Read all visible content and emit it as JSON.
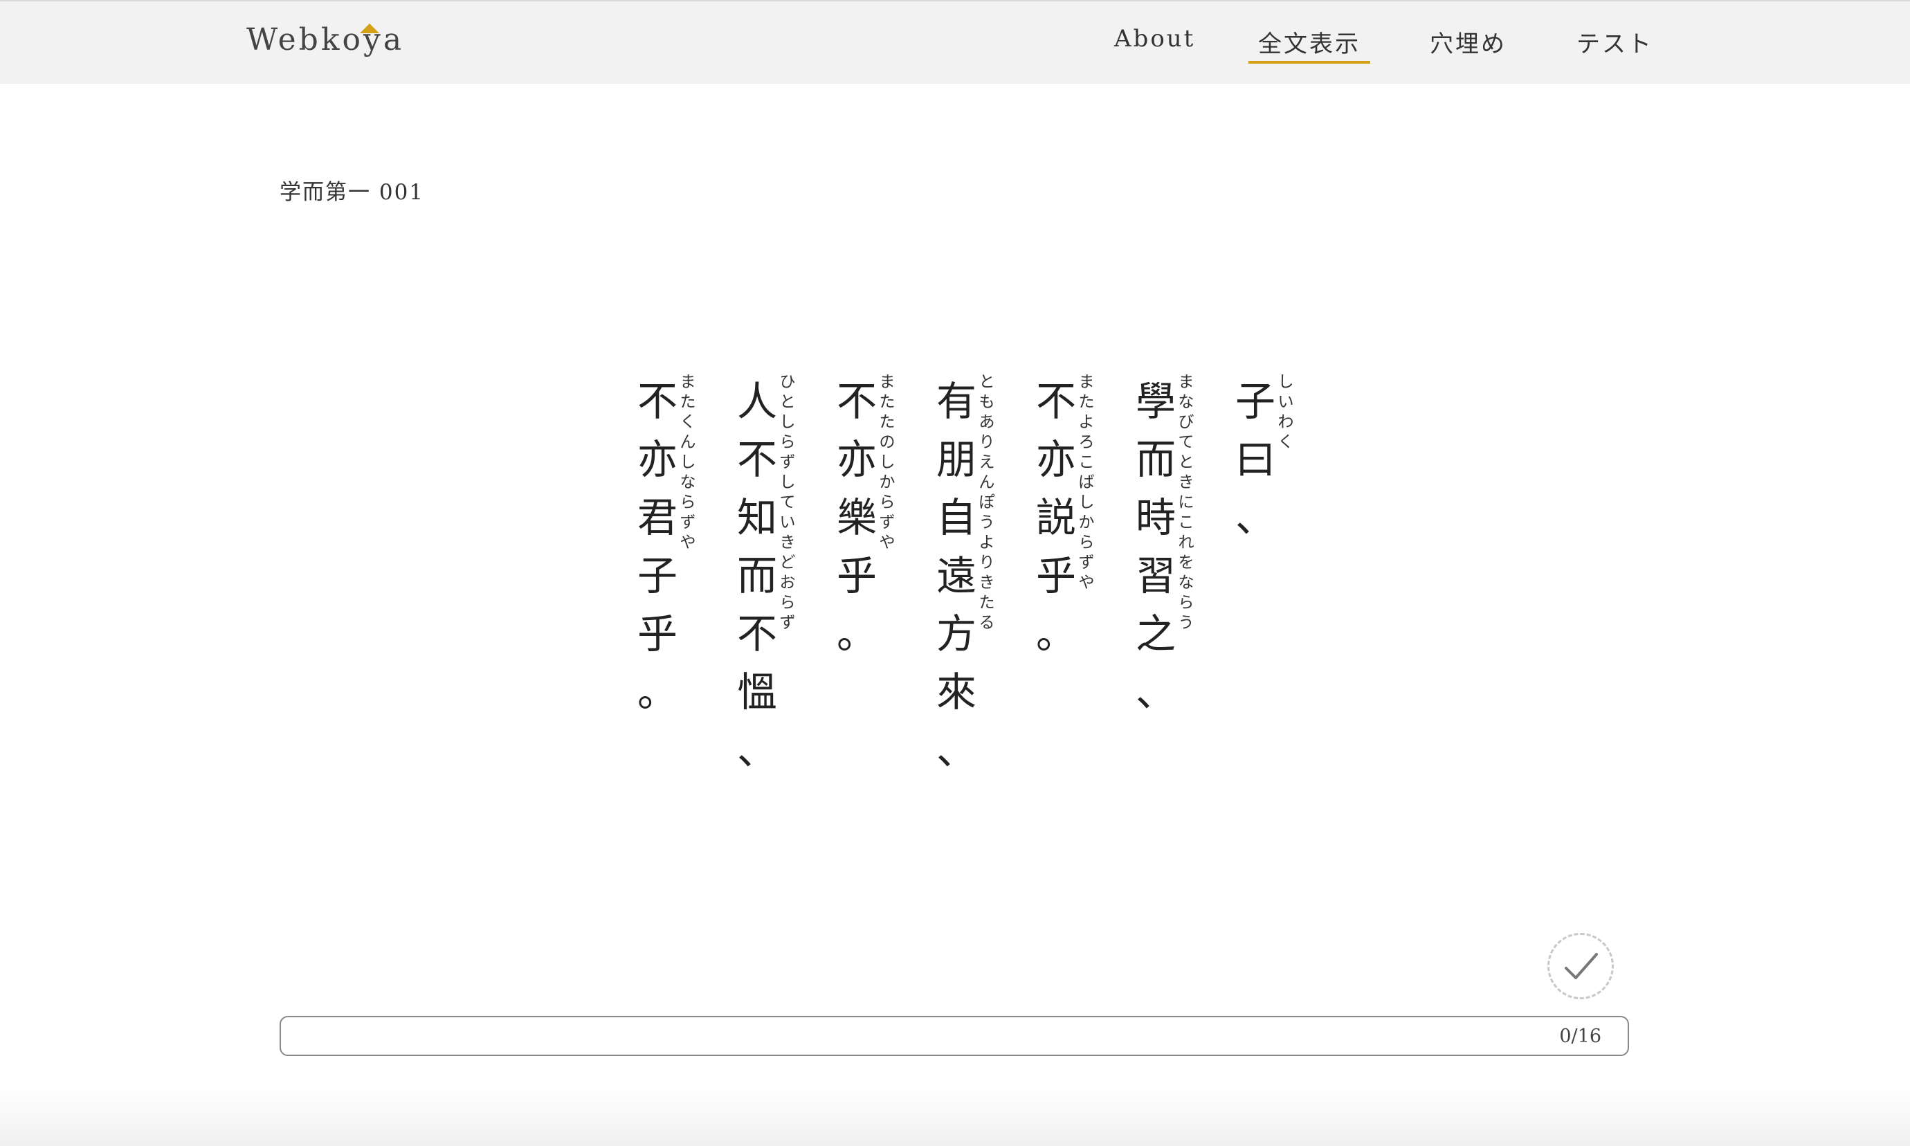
{
  "header": {
    "logo": "Webkoya",
    "accent_color": "#d4a017",
    "nav": [
      {
        "label": "About",
        "active": false
      },
      {
        "label": "全文表示",
        "active": true
      },
      {
        "label": "穴埋め",
        "active": false
      },
      {
        "label": "テスト",
        "active": false
      }
    ]
  },
  "section": {
    "title": "学而第一 001"
  },
  "passage": {
    "columns": [
      {
        "text": "子曰、",
        "ruby": "しいわく"
      },
      {
        "text": "學而時習之、",
        "ruby": "まなびてときにこれをならう"
      },
      {
        "text": "不亦説乎。",
        "ruby": "またよろこばしからずや"
      },
      {
        "text": "有朋自遠方來、",
        "ruby": "ともありえんぽうよりきたる"
      },
      {
        "text": "不亦樂乎。",
        "ruby": "またたのしからずや"
      },
      {
        "text": "人不知而不慍、",
        "ruby": "ひとしらずしていきどおらず"
      },
      {
        "text": "不亦君子乎。",
        "ruby": "またくんしならずや"
      }
    ]
  },
  "check_button": {
    "icon": "checkmark-icon"
  },
  "progress": {
    "text": "0/16",
    "fraction": 0
  }
}
